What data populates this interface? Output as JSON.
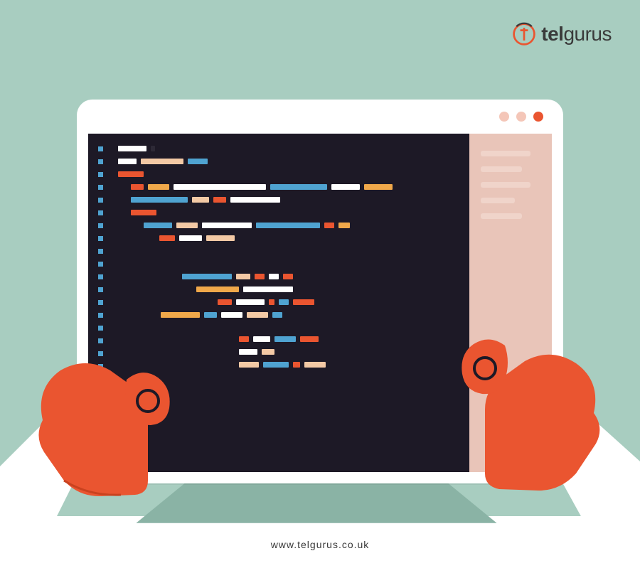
{
  "logo": {
    "brand_bold": "tel",
    "brand_light": "gurus"
  },
  "footer": {
    "url": "www.telgurus.co.uk"
  },
  "window": {
    "dots": [
      "minimize",
      "maximize",
      "close"
    ]
  },
  "sidebar": {
    "items": [
      "",
      "",
      "",
      "",
      ""
    ]
  }
}
